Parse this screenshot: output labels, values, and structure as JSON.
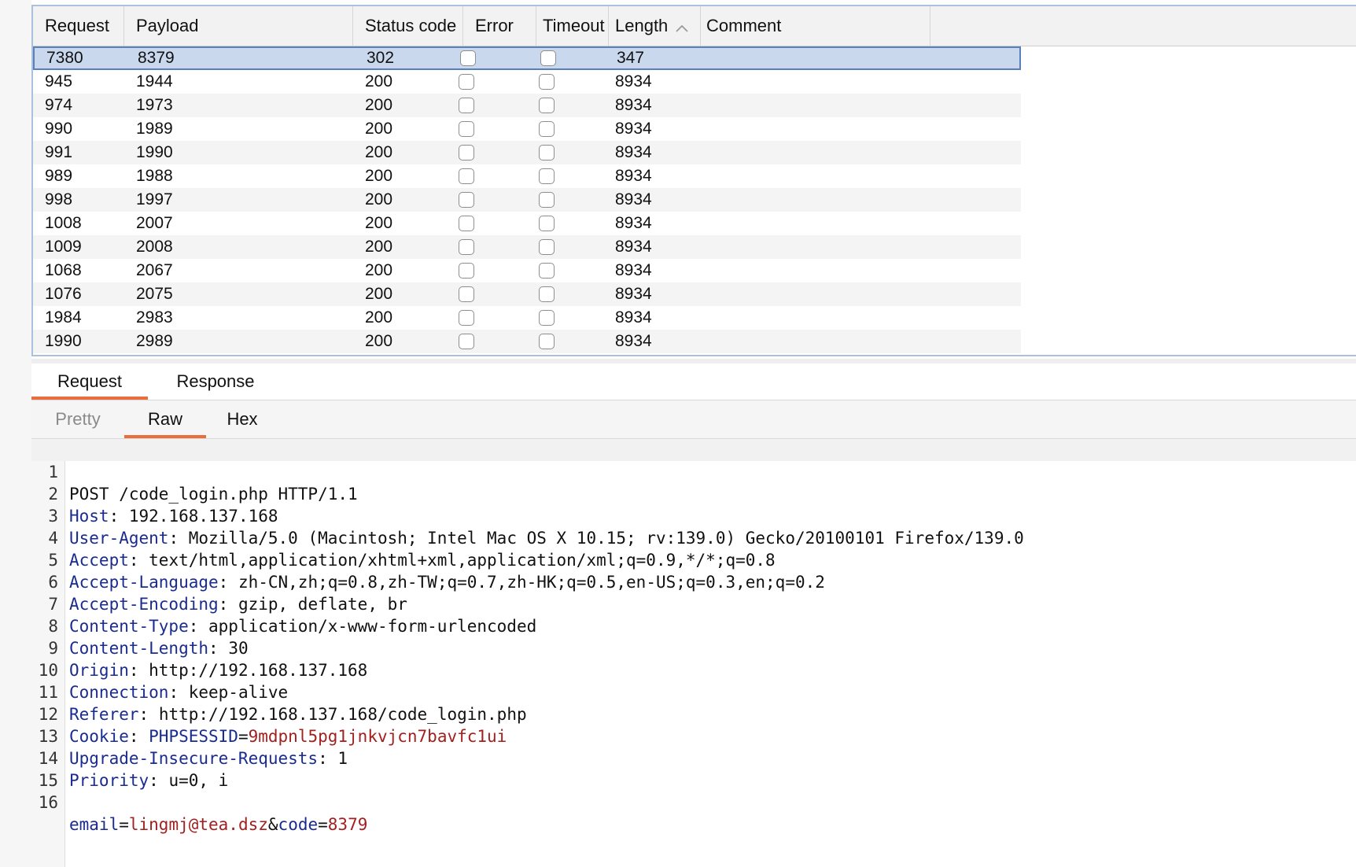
{
  "table": {
    "columns": [
      "Request",
      "Payload",
      "Status code",
      "Error",
      "Timeout",
      "Length",
      "Comment"
    ],
    "rows": [
      {
        "request": "7380",
        "payload": "8379",
        "status": "302",
        "length": "347",
        "selected": true
      },
      {
        "request": "945",
        "payload": "1944",
        "status": "200",
        "length": "8934"
      },
      {
        "request": "974",
        "payload": "1973",
        "status": "200",
        "length": "8934"
      },
      {
        "request": "990",
        "payload": "1989",
        "status": "200",
        "length": "8934"
      },
      {
        "request": "991",
        "payload": "1990",
        "status": "200",
        "length": "8934"
      },
      {
        "request": "989",
        "payload": "1988",
        "status": "200",
        "length": "8934"
      },
      {
        "request": "998",
        "payload": "1997",
        "status": "200",
        "length": "8934"
      },
      {
        "request": "1008",
        "payload": "2007",
        "status": "200",
        "length": "8934"
      },
      {
        "request": "1009",
        "payload": "2008",
        "status": "200",
        "length": "8934"
      },
      {
        "request": "1068",
        "payload": "2067",
        "status": "200",
        "length": "8934"
      },
      {
        "request": "1076",
        "payload": "2075",
        "status": "200",
        "length": "8934"
      },
      {
        "request": "1984",
        "payload": "2983",
        "status": "200",
        "length": "8934"
      },
      {
        "request": "1990",
        "payload": "2989",
        "status": "200",
        "length": "8934"
      }
    ]
  },
  "tabs": {
    "main": [
      "Request",
      "Response"
    ],
    "active_main": 0,
    "sub": [
      "Pretty",
      "Raw",
      "Hex"
    ],
    "active_sub": 1
  },
  "raw_request": {
    "request_line": "POST /code_login.php HTTP/1.1",
    "headers": [
      {
        "name": "Host",
        "value": "192.168.137.168"
      },
      {
        "name": "User-Agent",
        "value": "Mozilla/5.0 (Macintosh; Intel Mac OS X 10.15; rv:139.0) Gecko/20100101 Firefox/139.0"
      },
      {
        "name": "Accept",
        "value": "text/html,application/xhtml+xml,application/xml;q=0.9,*/*;q=0.8"
      },
      {
        "name": "Accept-Language",
        "value": "zh-CN,zh;q=0.8,zh-TW;q=0.7,zh-HK;q=0.5,en-US;q=0.3,en;q=0.2"
      },
      {
        "name": "Accept-Encoding",
        "value": "gzip, deflate, br"
      },
      {
        "name": "Content-Type",
        "value": "application/x-www-form-urlencoded"
      },
      {
        "name": "Content-Length",
        "value": "30"
      },
      {
        "name": "Origin",
        "value": "http://192.168.137.168"
      },
      {
        "name": "Connection",
        "value": "keep-alive"
      },
      {
        "name": "Referer",
        "value": "http://192.168.137.168/code_login.php"
      },
      {
        "name": "Cookie",
        "cookie_name": "PHPSESSID",
        "cookie_value": "9mdpnl5pg1jnkvjcn7bavfc1ui"
      },
      {
        "name": "Upgrade-Insecure-Requests",
        "value": "1"
      },
      {
        "name": "Priority",
        "value": "u=0, i"
      }
    ],
    "body": [
      {
        "name": "email",
        "value": "lingmj@tea.dsz"
      },
      {
        "name": "code",
        "value": "8379"
      }
    ],
    "line_numbers": [
      "1",
      "2",
      "3",
      "4",
      "5",
      "6",
      "7",
      "8",
      "9",
      "10",
      "11",
      "12",
      "13",
      "14",
      "15",
      "16"
    ]
  },
  "icons": {
    "sort": "chevron-up-icon"
  },
  "colors": {
    "accent": "#e86f3c",
    "selection": "#cad8ee",
    "header_name": "#1a2b8f",
    "param_value": "#a0211f"
  }
}
